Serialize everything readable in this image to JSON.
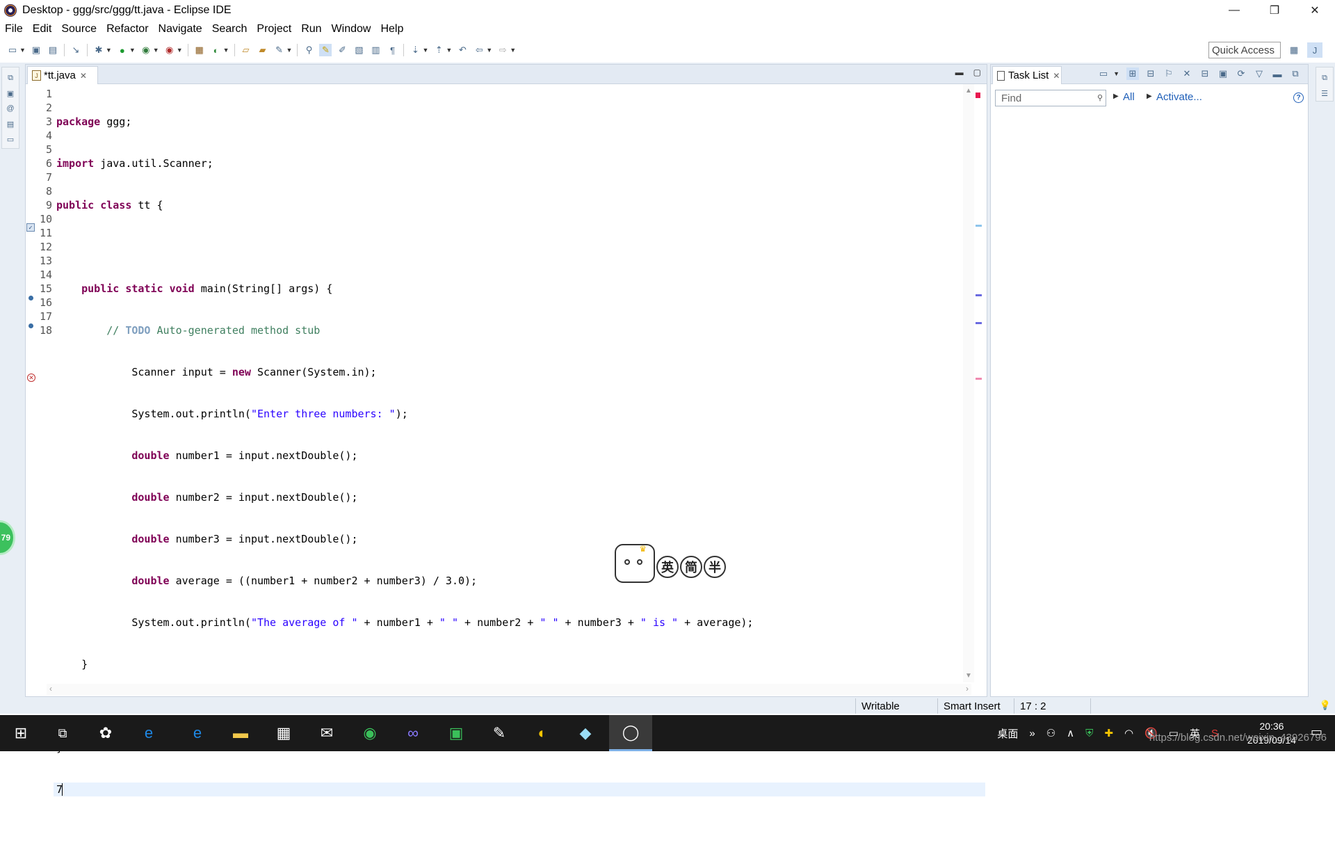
{
  "window": {
    "title": "Desktop - ggg/src/ggg/tt.java - Eclipse IDE",
    "minimize": "—",
    "restore": "❐",
    "close": "✕"
  },
  "menu": [
    "File",
    "Edit",
    "Source",
    "Refactor",
    "Navigate",
    "Search",
    "Project",
    "Run",
    "Window",
    "Help"
  ],
  "toolbar": {
    "quick_access": "Quick Access"
  },
  "editor": {
    "tab_label": "*tt.java",
    "line_numbers": [
      "1",
      "2",
      "3",
      "4",
      "5",
      "6",
      "7",
      "8",
      "9",
      "10",
      "11",
      "12",
      "13",
      "14",
      "15",
      "16",
      "17",
      "18"
    ],
    "lines": {
      "l1_kw": "package",
      "l1_rest": " ggg;",
      "l2_kw": "import",
      "l2_rest": " java.util.Scanner;",
      "l3_kw1": "public",
      "l3_kw2": "class",
      "l3_rest": " tt {",
      "l5_kw1": "public",
      "l5_kw2": "static",
      "l5_kw3": "void",
      "l5_rest": " main(String[] args) {",
      "l6_cmt1": "// ",
      "l6_todo": "TODO",
      "l6_cmt2": " Auto-generated method stub",
      "l7_pre": "Scanner input = ",
      "l7_kw": "new",
      "l7_rest": " Scanner(System.in);",
      "l8_pre": "System.out.println(",
      "l8_str": "\"Enter three numbers: \"",
      "l8_post": ");",
      "l9_kw": "double",
      "l9_rest": " number1 = input.nextDouble();",
      "l10_kw": "double",
      "l10_rest": " number2 = input.nextDouble();",
      "l11_kw": "double",
      "l11_rest": " number3 = input.nextDouble();",
      "l12_kw": "double",
      "l12_rest": " average = ((number1 + number2 + number3) / 3.0);",
      "l13_pre": "System.out.println(",
      "l13_s1": "\"The average of \"",
      "l13_m1": " + number1 + ",
      "l13_s2": "\" \"",
      "l13_m2": " + number2 + ",
      "l13_s3": "\" \"",
      "l13_m3": " + number3 + ",
      "l13_s4": "\" is \"",
      "l13_post": " + average);",
      "l14": "}",
      "l16": "}",
      "l17": "7"
    }
  },
  "tasklist": {
    "tab_label": "Task List",
    "find_placeholder": "Find",
    "all_link": "All",
    "activate_link": "Activate..."
  },
  "status": {
    "writable": "Writable",
    "insert_mode": "Smart Insert",
    "position": "17 : 2"
  },
  "floating": {
    "ball_value": "79",
    "ime_chars": [
      "英",
      "简",
      "半"
    ]
  },
  "taskbar": {
    "desktop_label": "桌面",
    "ime_label": "英",
    "time": "20:36",
    "date": "2019/09/14",
    "watermark": "https://blog.csdn.net/weixin_43926796"
  },
  "colors": {
    "keyword": "#7f0055",
    "string": "#2a00ff",
    "comment": "#3f7f5f",
    "link": "#1f5fb8"
  }
}
